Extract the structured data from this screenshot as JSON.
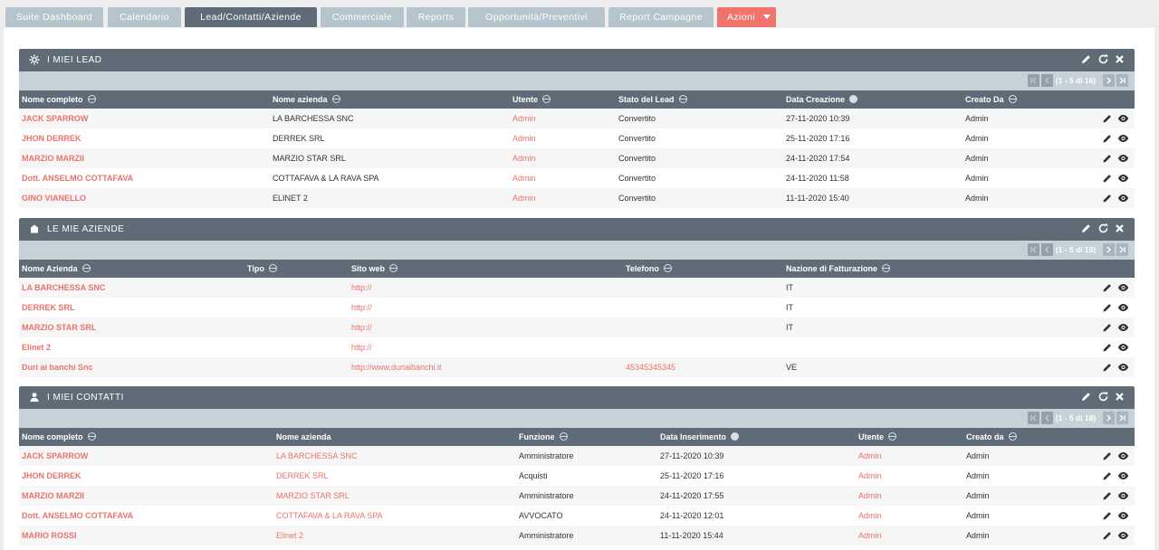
{
  "nav": {
    "tabs": [
      {
        "label": "Suite Dashboard",
        "active": false
      },
      {
        "label": "Calendario",
        "active": false
      },
      {
        "label": "Lead/Contatti/Aziende",
        "active": true
      },
      {
        "label": "Commerciale",
        "active": false
      },
      {
        "label": "Reports",
        "active": false
      },
      {
        "label": "Opportunità/Preventivi",
        "active": false
      },
      {
        "label": "Report Campagne",
        "active": false
      }
    ],
    "actions_label": "Azioni"
  },
  "colors": {
    "header": "#5f6c78",
    "pager": "#c7d2d8",
    "link": "#e8736b",
    "actions": "#f0736c"
  },
  "leads": {
    "title": "I MIEI LEAD",
    "icon": "gear-icon",
    "pagination": "(1 - 5 di 16)",
    "columns": [
      "Nome completo",
      "Nome azienda",
      "Utente",
      "Stato del Lead",
      "Data Creazione",
      "Creato Da"
    ],
    "rows": [
      {
        "name": "JACK SPARROW",
        "company": "LA BARCHESSA SNC",
        "user": "Admin",
        "status": "Convertito",
        "created": "27-11-2020 10:39",
        "created_by": "Admin"
      },
      {
        "name": "JHON DERREK",
        "company": "DERREK SRL",
        "user": "Admin",
        "status": "Convertito",
        "created": "25-11-2020 17:16",
        "created_by": "Admin"
      },
      {
        "name": "MARZIO MARZII",
        "company": "MARZIO STAR SRL",
        "user": "Admin",
        "status": "Convertito",
        "created": "24-11-2020 17:54",
        "created_by": "Admin"
      },
      {
        "name": "Dott. ANSELMO COTTAFAVA",
        "company": "COTTAFAVA & LA RAVA SPA",
        "user": "Admin",
        "status": "Convertito",
        "created": "24-11-2020 11:58",
        "created_by": "Admin"
      },
      {
        "name": "GINO VIANELLO",
        "company": "ELINET 2",
        "user": "Admin",
        "status": "Convertito",
        "created": "11-11-2020 15:40",
        "created_by": "Admin"
      }
    ]
  },
  "aziende": {
    "title": "LE MIE AZIENDE",
    "icon": "building-icon",
    "pagination": "(1 - 5 di 10)",
    "columns": [
      "Nome Azienda",
      "Tipo",
      "Sito web",
      "Telefono",
      "Nazione di Fatturazione"
    ],
    "rows": [
      {
        "name": "LA BARCHESSA SNC",
        "type": "",
        "website": "http://",
        "phone": "",
        "country": "IT"
      },
      {
        "name": "DERREK SRL",
        "type": "",
        "website": "http://",
        "phone": "",
        "country": "IT"
      },
      {
        "name": "MARZIO STAR SRL",
        "type": "",
        "website": "http://",
        "phone": "",
        "country": "IT"
      },
      {
        "name": "Elinet 2",
        "type": "",
        "website": "http://",
        "phone": "",
        "country": ""
      },
      {
        "name": "Duri ai banchi Snc",
        "type": "",
        "website": "http://www.duriaibanchi.it",
        "phone": "45345345345",
        "country": "VE"
      }
    ]
  },
  "contatti": {
    "title": "I MIEI CONTATTI",
    "icon": "user-icon",
    "pagination": "(1 - 5 di 18)",
    "columns": [
      "Nome completo",
      "Nome azienda",
      "Funzione",
      "Data Inserimento",
      "Utente",
      "Creato da"
    ],
    "rows": [
      {
        "name": "JACK SPARROW",
        "company": "LA BARCHESSA SNC",
        "role": "Amministratore",
        "inserted": "27-11-2020 10:39",
        "user": "Admin",
        "created_by": "Admin"
      },
      {
        "name": "JHON DERREK",
        "company": "DERREK SRL",
        "role": "Acquisti",
        "inserted": "25-11-2020 17:16",
        "user": "Admin",
        "created_by": "Admin"
      },
      {
        "name": "MARZIO MARZII",
        "company": "MARZIO STAR SRL",
        "role": "Amministratore",
        "inserted": "24-11-2020 17:55",
        "user": "Admin",
        "created_by": "Admin"
      },
      {
        "name": "Dott. ANSELMO COTTAFAVA",
        "company": "COTTAFAVA & LA RAVA SPA",
        "role": "AVVOCATO",
        "inserted": "24-11-2020 12:01",
        "user": "Admin",
        "created_by": "Admin"
      },
      {
        "name": "MARIO ROSSI",
        "company": "Elinet 2",
        "role": "Amministratore",
        "inserted": "11-11-2020 15:44",
        "user": "Admin",
        "created_by": "Admin"
      }
    ]
  }
}
